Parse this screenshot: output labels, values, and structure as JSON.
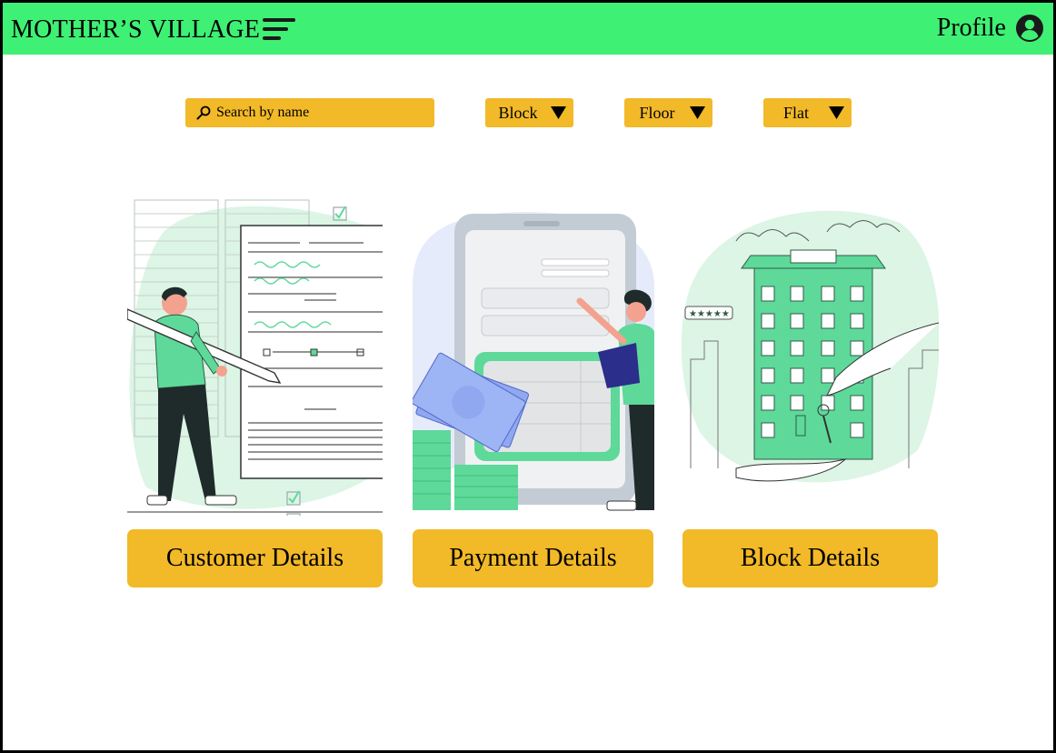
{
  "header": {
    "brand": "MOTHER’S VILLAGE",
    "menu_icon": "hamburger-menu-icon",
    "profile_label": "Profile",
    "profile_icon": "user-circle-icon"
  },
  "filters": {
    "search_placeholder": "Search by name",
    "search_icon": "search-icon",
    "block_label": "Block",
    "floor_label": "Floor",
    "flat_label": "Flat",
    "caret_icon": "caret-down-icon"
  },
  "cards": [
    {
      "label": "Customer Details",
      "illustration": "form-filling-illustration"
    },
    {
      "label": "Payment Details",
      "illustration": "payment-illustration"
    },
    {
      "label": "Block Details",
      "illustration": "apartment-keys-illustration"
    }
  ],
  "colors": {
    "header_bg": "#3ef074",
    "accent": "#f2b928",
    "illustration_green": "#5ed99a",
    "illustration_light_green": "#dcf5e5"
  }
}
